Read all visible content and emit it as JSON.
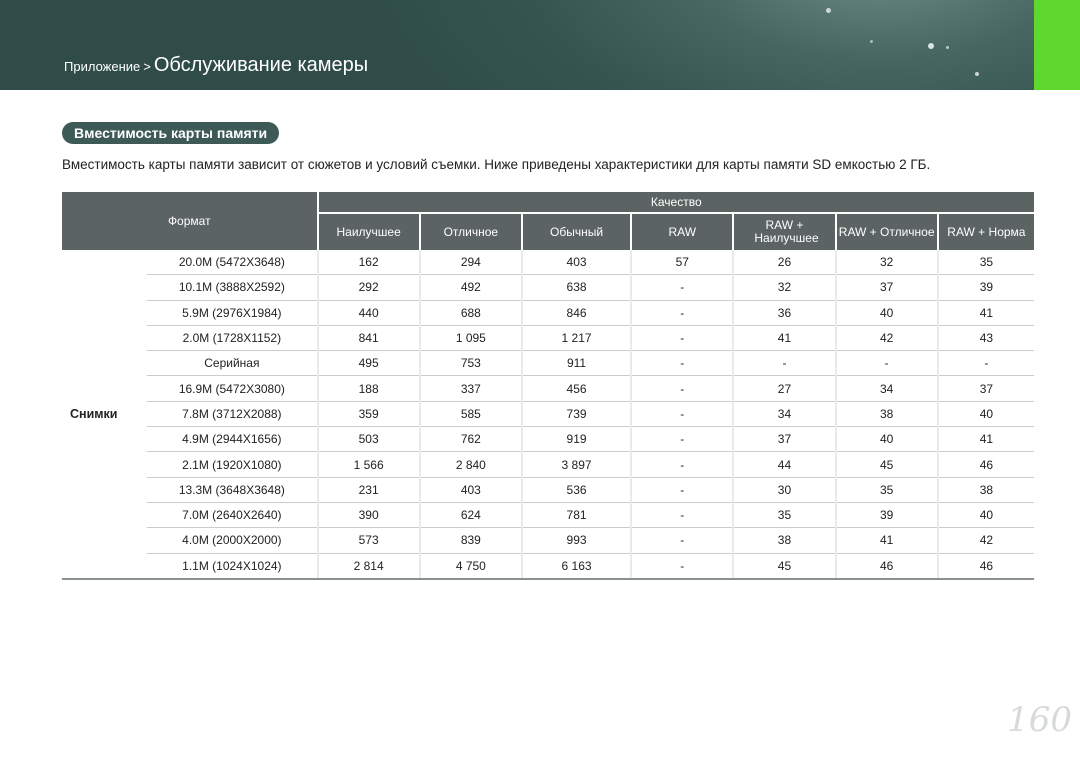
{
  "header": {
    "breadcrumb_parent": "Приложение",
    "breadcrumb_separator": ">",
    "breadcrumb_current": "Обслуживание камеры",
    "accent_color": "#5ed82e",
    "background_color": "#3d5a56"
  },
  "section": {
    "title": "Вместимость карты памяти",
    "intro": "Вместимость карты памяти зависит от сюжетов и условий съемки. Ниже приведены характеристики для карты памяти SD емкостью 2 ГБ."
  },
  "table": {
    "format_header": "Формат",
    "quality_header": "Качество",
    "quality_columns": [
      "Наилучшее",
      "Отличное",
      "Обычный",
      "RAW",
      "RAW + Наилучшее",
      "RAW + Отличное",
      "RAW + Норма"
    ],
    "group_label": "Снимки",
    "rows": [
      {
        "format": "20.0M (5472X3648)",
        "values": [
          "162",
          "294",
          "403",
          "57",
          "26",
          "32",
          "35"
        ]
      },
      {
        "format": "10.1M (3888X2592)",
        "values": [
          "292",
          "492",
          "638",
          "-",
          "32",
          "37",
          "39"
        ]
      },
      {
        "format": "5.9M (2976X1984)",
        "values": [
          "440",
          "688",
          "846",
          "-",
          "36",
          "40",
          "41"
        ]
      },
      {
        "format": "2.0M (1728X1152)",
        "values": [
          "841",
          "1 095",
          "1 217",
          "-",
          "41",
          "42",
          "43"
        ]
      },
      {
        "format": "Серийная",
        "values": [
          "495",
          "753",
          "911",
          "-",
          "-",
          "-",
          "-"
        ]
      },
      {
        "format": "16.9M (5472X3080)",
        "values": [
          "188",
          "337",
          "456",
          "-",
          "27",
          "34",
          "37"
        ]
      },
      {
        "format": "7.8M (3712X2088)",
        "values": [
          "359",
          "585",
          "739",
          "-",
          "34",
          "38",
          "40"
        ]
      },
      {
        "format": "4.9M (2944X1656)",
        "values": [
          "503",
          "762",
          "919",
          "-",
          "37",
          "40",
          "41"
        ]
      },
      {
        "format": "2.1M (1920X1080)",
        "values": [
          "1 566",
          "2 840",
          "3 897",
          "-",
          "44",
          "45",
          "46"
        ]
      },
      {
        "format": "13.3M (3648X3648)",
        "values": [
          "231",
          "403",
          "536",
          "-",
          "30",
          "35",
          "38"
        ]
      },
      {
        "format": "7.0M (2640X2640)",
        "values": [
          "390",
          "624",
          "781",
          "-",
          "35",
          "39",
          "40"
        ]
      },
      {
        "format": "4.0M (2000X2000)",
        "values": [
          "573",
          "839",
          "993",
          "-",
          "38",
          "41",
          "42"
        ]
      },
      {
        "format": "1.1M (1024X1024)",
        "values": [
          "2 814",
          "4 750",
          "6 163",
          "-",
          "45",
          "46",
          "46"
        ]
      }
    ]
  },
  "page_number": "160"
}
